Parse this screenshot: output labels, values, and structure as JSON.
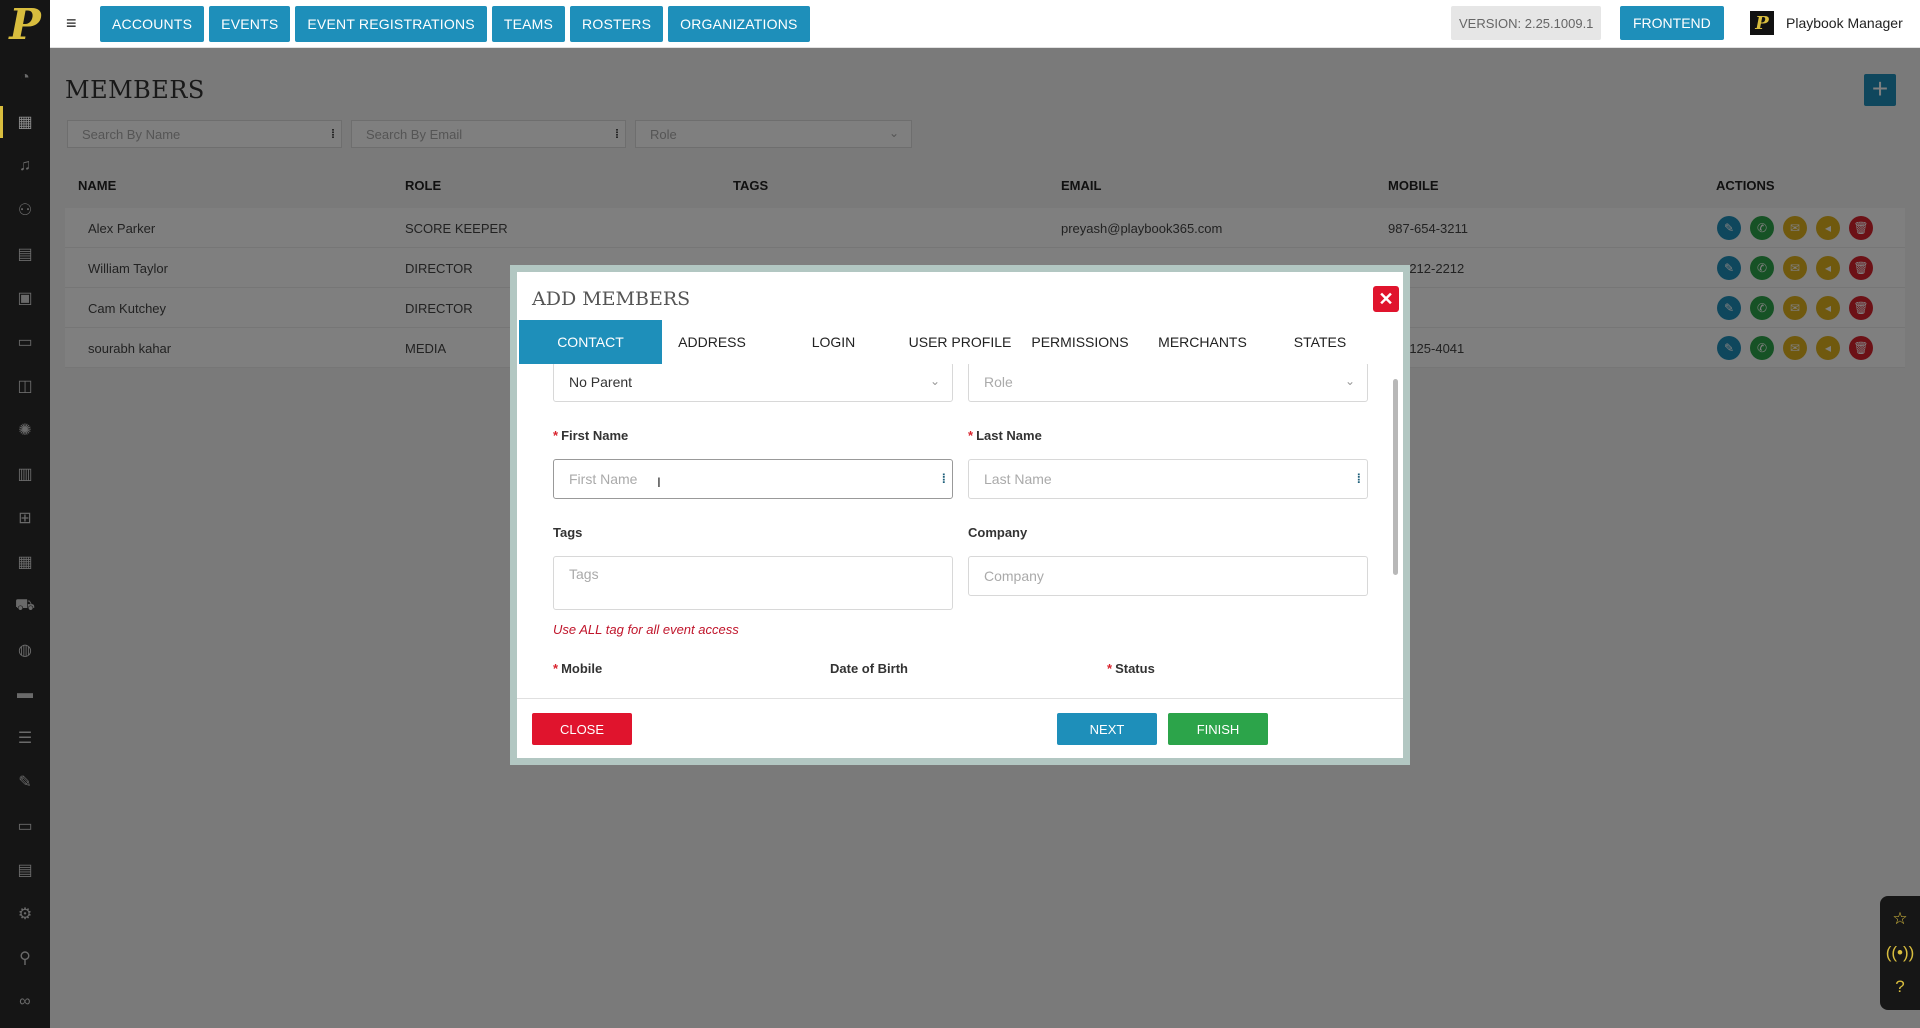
{
  "brand": {
    "logo_letter": "P"
  },
  "sidebar": {
    "icons": [
      "dashboard-icon",
      "calendar-icon",
      "music-icon",
      "group-icon",
      "book-icon",
      "contacts-icon",
      "chat-icon",
      "badge-icon",
      "palette-icon",
      "building-icon",
      "medkit-icon",
      "schedule-icon",
      "cart-icon",
      "ball-icon",
      "ticket-icon",
      "list-icon",
      "pen-icon",
      "folder-icon",
      "report-icon",
      "gear-icon",
      "link-icon",
      "infinity-icon"
    ]
  },
  "topbar": {
    "nav": [
      "ACCOUNTS",
      "EVENTS",
      "EVENT REGISTRATIONS",
      "TEAMS",
      "ROSTERS",
      "ORGANIZATIONS"
    ],
    "version": "VERSION: 2.25.1009.1",
    "frontend": "FRONTEND",
    "user_name": "Playbook Manager",
    "user_logo": "P"
  },
  "page": {
    "title": "MEMBERS",
    "add_label": "+",
    "filters": {
      "name_placeholder": "Search By Name",
      "email_placeholder": "Search By Email",
      "role_placeholder": "Role"
    }
  },
  "table": {
    "headers": {
      "name": "NAME",
      "role": "ROLE",
      "tags": "TAGS",
      "email": "EMAIL",
      "mobile": "MOBILE",
      "actions": "ACTIONS"
    },
    "rows": [
      {
        "name": "Alex Parker",
        "role": "SCORE KEEPER",
        "tags": "",
        "email": "preyash@playbook365.com",
        "mobile": "987-654-3211"
      },
      {
        "name": "William Taylor",
        "role": "DIRECTOR",
        "tags": "",
        "email": "",
        "mobile": "-212-2212"
      },
      {
        "name": "Cam Kutchey",
        "role": "DIRECTOR",
        "tags": "",
        "email": "",
        "mobile": ""
      },
      {
        "name": "sourabh kahar",
        "role": "MEDIA",
        "tags": "",
        "email": "",
        "mobile": "-125-4041"
      }
    ]
  },
  "modal": {
    "title": "ADD MEMBERS",
    "tabs": [
      "CONTACT",
      "ADDRESS",
      "LOGIN",
      "USER PROFILE",
      "PERMISSIONS",
      "MERCHANTS",
      "STATES"
    ],
    "active_tab": "CONTACT",
    "parent_value": "No Parent",
    "role_placeholder": "Role",
    "first_name_label": "First Name",
    "first_name_placeholder": "First Name",
    "last_name_label": "Last Name",
    "last_name_placeholder": "Last Name",
    "tags_label": "Tags",
    "tags_placeholder": "Tags",
    "company_label": "Company",
    "company_placeholder": "Company",
    "tags_hint": "Use ALL tag for all event access",
    "mobile_label": "Mobile",
    "dob_label": "Date of Birth",
    "status_label": "Status",
    "required_mark": "*",
    "close_label": "CLOSE",
    "next_label": "NEXT",
    "finish_label": "FINISH"
  },
  "colors": {
    "accent": "#1e8fba",
    "danger": "#e0142d",
    "success": "#2ca44a",
    "warning": "#e0b21d",
    "brand_gold": "#d8bd3e"
  }
}
